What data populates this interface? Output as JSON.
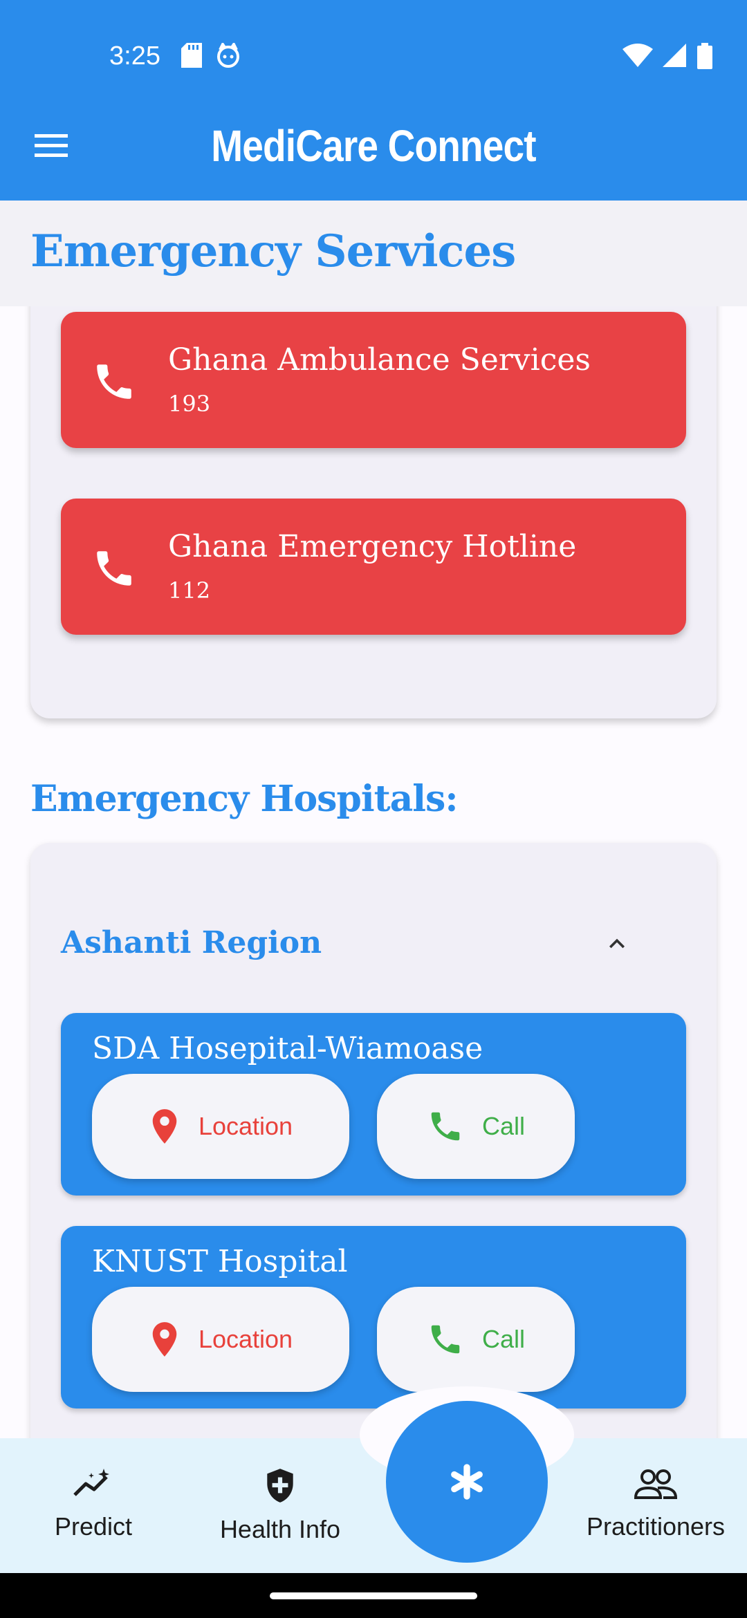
{
  "status_bar": {
    "time": "3:25",
    "left_icons": [
      "sd-card-icon",
      "cat-face-icon"
    ],
    "right_icons": [
      "wifi-icon",
      "signal-icon",
      "battery-icon"
    ]
  },
  "app_bar": {
    "title": "MediCare Connect",
    "menu_icon": "menu-icon"
  },
  "page": {
    "title": "Emergency Services"
  },
  "emergency_contacts": [
    {
      "name": "Ghana Ambulance Services",
      "number": "193"
    },
    {
      "name": "Ghana Emergency Hotline",
      "number": "112"
    }
  ],
  "hospitals": {
    "heading": "Emergency Hospitals:",
    "region": "Ashanti Region",
    "region_expanded": true,
    "items": [
      {
        "name": "SDA Hosepital-Wiamoase",
        "location_label": "Location",
        "call_label": "Call"
      },
      {
        "name": "KNUST Hospital",
        "location_label": "Location",
        "call_label": "Call"
      }
    ]
  },
  "bottom_nav": {
    "items": [
      {
        "label": "Predict",
        "icon": "trend-sparkle-icon"
      },
      {
        "label": "Health Info",
        "icon": "shield-plus-icon"
      },
      {
        "label": "Practitioners",
        "icon": "people-icon"
      }
    ],
    "fab_icon": "asterisk-icon"
  },
  "colors": {
    "primary": "#2a8ceb",
    "emergency_red": "#e84245",
    "location_red": "#e8413b",
    "call_green": "#3fae49",
    "panel_bg": "#f1eff7",
    "nav_bg": "#e2f3fc"
  }
}
